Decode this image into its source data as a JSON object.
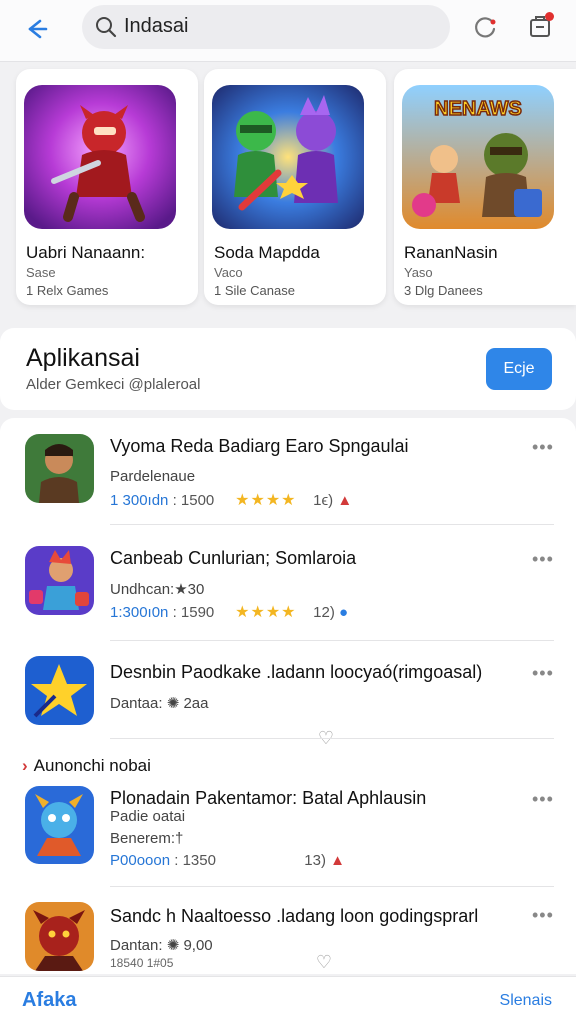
{
  "header": {
    "search_value": "Indasai"
  },
  "featured": [
    {
      "title": "Uabri Nanaann:",
      "sub1": "Sase",
      "sub2": "1 Relx Games"
    },
    {
      "title": "Soda Mapdda",
      "sub1": "Vaco",
      "sub2": "1 Sile Canase"
    },
    {
      "title": "RananNasin",
      "sub1": "Yaso",
      "sub2": "3 Dlg Danees",
      "art_text": "NENAWS"
    }
  ],
  "section": {
    "title": "Aplikansai",
    "subtitle": "Alder Gemkeci @plaleroal",
    "button": "Ecje"
  },
  "list": [
    {
      "title": "Vyoma Reda Badiarg Earo Spngaulai",
      "line2": "Pardelenaue",
      "price": "1 300ıdn",
      "count": ": 1500",
      "stars": "★★★★",
      "rating": "1ϵ)",
      "badge": "▲"
    },
    {
      "title": "Canbeab Cunlurian; Somlaroia",
      "line2": "Undhcan:★30",
      "price": "1:300ı0n",
      "count": ": 1590",
      "stars": "★★★★",
      "rating": "12)",
      "badge": "●"
    },
    {
      "title": "Desnbin Paodkake .ladann loocyaó(rimgoasal)",
      "line2": "Dantaa: ✺ 2aa"
    },
    {
      "title": "Plonadain Pakentamor: Batal Aphlausin",
      "line2": "Padie oatai",
      "line3": "Benerem:†",
      "price": "P00ooon",
      "count": ": 1350",
      "rating": "13)",
      "badge": "▲"
    },
    {
      "title": "Sandc h Naaltoesso .ladang loon godingsprarl",
      "line2": "Dantan: ✺ 9,00",
      "line3": "18540 1#05"
    }
  ],
  "section2": {
    "label": "Aunonchi nobai"
  },
  "bottom": {
    "logo": "Afaka",
    "right": "Slenais"
  }
}
